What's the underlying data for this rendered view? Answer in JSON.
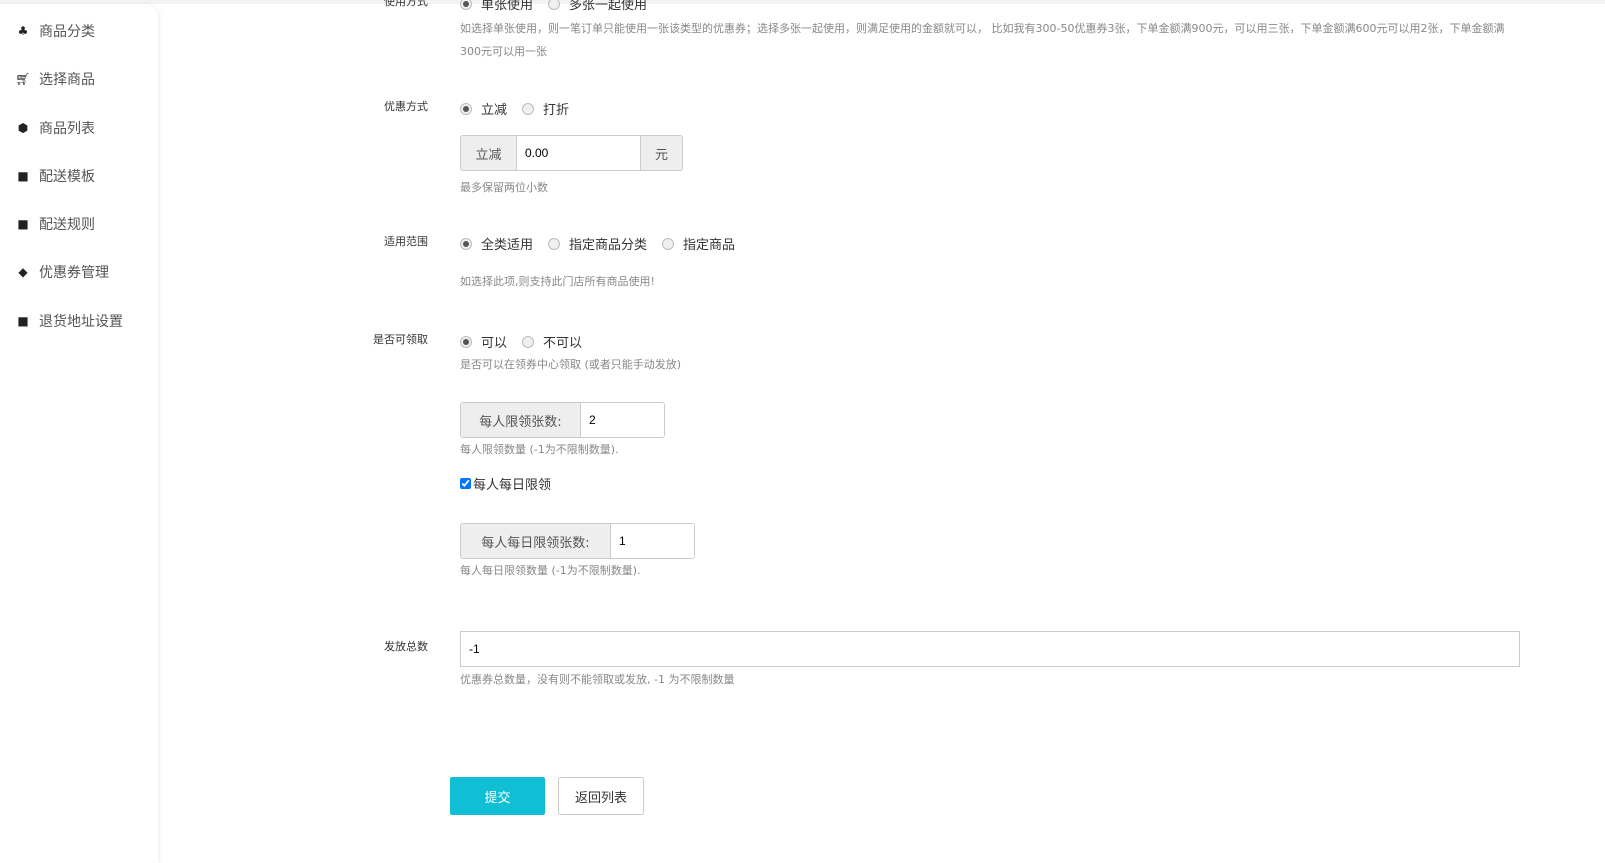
{
  "sidebar": {
    "items": [
      {
        "label": "商品分类",
        "icon": "sitemap-icon"
      },
      {
        "label": "选择商品",
        "icon": "cart-icon"
      },
      {
        "label": "商品列表",
        "icon": "cubes-icon"
      },
      {
        "label": "配送模板",
        "icon": "truck-icon"
      },
      {
        "label": "配送规则",
        "icon": "truck-icon"
      },
      {
        "label": "优惠券管理",
        "icon": "tags-icon"
      },
      {
        "label": "退货地址设置",
        "icon": "truck-icon"
      }
    ]
  },
  "usage": {
    "label": "使用方式",
    "options": [
      "单张使用",
      "多张一起使用"
    ],
    "help1": "如选择单张使用，则一笔订单只能使用一张该类型的优惠券；选择多张一起使用，则满足使用的金额就可以， 比如我有300-50优惠券3张，下单金额满900元，可以用三张，下单金额满600元可以用2张，下单金额满",
    "help2": "300元可以用一张"
  },
  "discount": {
    "label": "优惠方式",
    "options": [
      "立减",
      "打折"
    ],
    "prefix": "立减",
    "value": "0.00",
    "suffix": "元",
    "help": "最多保留两位小数"
  },
  "scope": {
    "label": "适用范围",
    "options": [
      "全类适用",
      "指定商品分类",
      "指定商品"
    ],
    "help": "如选择此项,则支持此门店所有商品使用!"
  },
  "claimable": {
    "label": "是否可领取",
    "options": [
      "可以",
      "不可以"
    ],
    "help": "是否可以在领券中心领取 (或者只能手动发放)"
  },
  "per_person": {
    "prefix": "每人限领张数:",
    "value": "2",
    "help": "每人限领数量 (-1为不限制数量)."
  },
  "daily": {
    "checkbox_label": "每人每日限领",
    "checked": true,
    "prefix": "每人每日限领张数:",
    "value": "1",
    "help": "每人每日限领数量 (-1为不限制数量)."
  },
  "total": {
    "label": "发放总数",
    "value": "-1",
    "help": "优惠券总数量，没有则不能领取或发放, -1 为不限制数量"
  },
  "actions": {
    "submit": "提交",
    "back": "返回列表"
  },
  "colors": {
    "primary": "#11bfd4"
  }
}
